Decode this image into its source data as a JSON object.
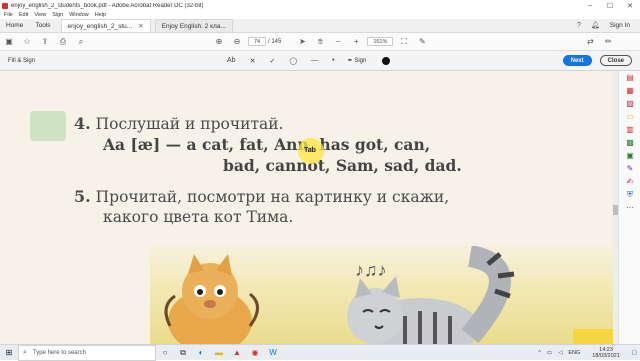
{
  "window": {
    "title": "enjoy_english_2_students_book.pdf - Adobe Acrobat Reader DC (32-bit)",
    "controls": [
      "–",
      "☐",
      "✕"
    ]
  },
  "menu": [
    "File",
    "Edit",
    "View",
    "Sign",
    "Window",
    "Help"
  ],
  "tabs": {
    "home": "Home",
    "tools": "Tools",
    "doc1": "enjoy_english_2_stu...",
    "doc2": "Enjoy English. 2 кла...",
    "close": "✕",
    "sign_in": "Sign In"
  },
  "toolbar": {
    "page_current": "74",
    "page_total": "/ 145",
    "zoom": "161%"
  },
  "fill_sign": {
    "title": "Fill & Sign",
    "text_tool": "Ab",
    "sign_label": "Sign",
    "next": "Next",
    "close": "Close"
  },
  "content": {
    "ex4_num": "4.",
    "ex4_line1": "Послушай и прочитай.",
    "ex4_line2": "Aa [æ] — a cat, fat, Ann, has got, can,",
    "ex4_line3": "bad, cannot, Sam, sad, dad.",
    "ex5_num": "5.",
    "ex5_line1": "Прочитай, посмотри на картинку и скажи,",
    "ex5_line2": "какого цвета кот Тима.",
    "cursor_label": "Tab"
  },
  "taskbar": {
    "search_placeholder": "Type here to search",
    "lang": "ENG",
    "time": "14:23",
    "date": "18/03/2021"
  },
  "colors": {
    "accent": "#1473e6",
    "highlight": "#ffe63c"
  }
}
